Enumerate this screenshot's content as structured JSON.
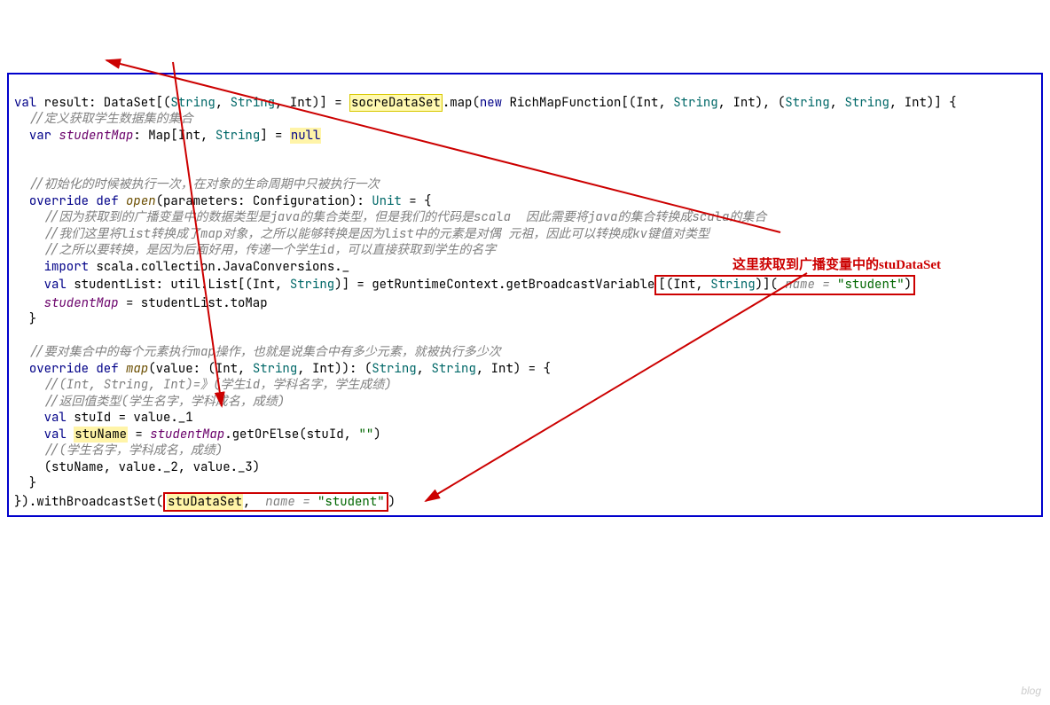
{
  "lines": {
    "l1a": "val",
    "l1b": " result: DataSet[(",
    "l1c": "String",
    "l1d": ", ",
    "l1e": "String",
    "l1f": ", Int)] = ",
    "l1g": "socreDataSet",
    "l1h": ".map(",
    "l1i": "new",
    "l1j": " RichMapFunction[(Int, ",
    "l1k": "String",
    "l1l": ", Int), (",
    "l1m": "String",
    "l1n": ", ",
    "l1o": "String",
    "l1p": ", Int)] {",
    "l2": "  //定义获取学生数据集的集合",
    "l3a": "  ",
    "l3b": "var",
    "l3c": " ",
    "l3d": "studentMap",
    "l3e": ": Map[Int, ",
    "l3f": "String",
    "l3g": "] = ",
    "l3h": "null",
    "l4": "",
    "l5": "",
    "l6": "  //初始化的时候被执行一次，在对象的生命周期中只被执行一次",
    "l7a": "  ",
    "l7b": "override def ",
    "l7c": "open",
    "l7d": "(parameters: Configuration): ",
    "l7e": "Unit",
    "l7f": " = {",
    "l8": "    //因为获取到的广播变量中的数据类型是java的集合类型，但是我们的代码是scala  因此需要将java的集合转换成scala的集合",
    "l9": "    //我们这里将list转换成了map对象，之所以能够转换是因为list中的元素是对偶 元祖，因此可以转换成kv键值对类型",
    "l10": "    //之所以要转换，是因为后面好用，传递一个学生id，可以直接获取到学生的名字",
    "l11a": "    ",
    "l11b": "import",
    "l11c": " scala.collection.JavaConversions._",
    "l12a": "    ",
    "l12b": "val",
    "l12c": " studentList: util.List[(Int, ",
    "l12d": "String",
    "l12e": ")] = getRuntimeContext.getBroadcastVariable",
    "l12f": "[(Int, ",
    "l12g": "String",
    "l12h": ")](",
    "l12i": " name = ",
    "l12j": "\"student\"",
    "l12k": ")",
    "l13a": "    ",
    "l13b": "studentMap",
    "l13c": " = studentList.toMap",
    "l14": "  }",
    "l15": "",
    "l16": "  //要对集合中的每个元素执行map操作，也就是说集合中有多少元素，就被执行多少次",
    "l17a": "  ",
    "l17b": "override def ",
    "l17c": "map",
    "l17d": "(value: (Int, ",
    "l17e": "String",
    "l17f": ", Int)): (",
    "l17g": "String",
    "l17h": ", ",
    "l17i": "String",
    "l17j": ", Int) = {",
    "l18": "    //(Int, String, Int)=》(学生id，学科名字，学生成绩)",
    "l19": "    //返回值类型(学生名字，学科成名，成绩)",
    "l20a": "    ",
    "l20b": "val",
    "l20c": " stuId = value._1",
    "l21a": "    ",
    "l21b": "val",
    "l21c": " ",
    "l21d": "stuName",
    "l21e": " = ",
    "l21f": "studentMap",
    "l21g": ".getOrElse(stuId, ",
    "l21h": "\"\"",
    "l21i": ")",
    "l22": "    //(学生名字，学科成名，成绩)",
    "l23": "    (stuName, value._2, value._3)",
    "l24": "  }",
    "l25a": "}).withBroadcastSet(",
    "l25b": "stuDataSet",
    "l25c": ", ",
    "l25d": " name = ",
    "l25e": "\"student\"",
    "l25f": ")"
  },
  "annotation": "这里获取到广播变量中的stuDataSet"
}
